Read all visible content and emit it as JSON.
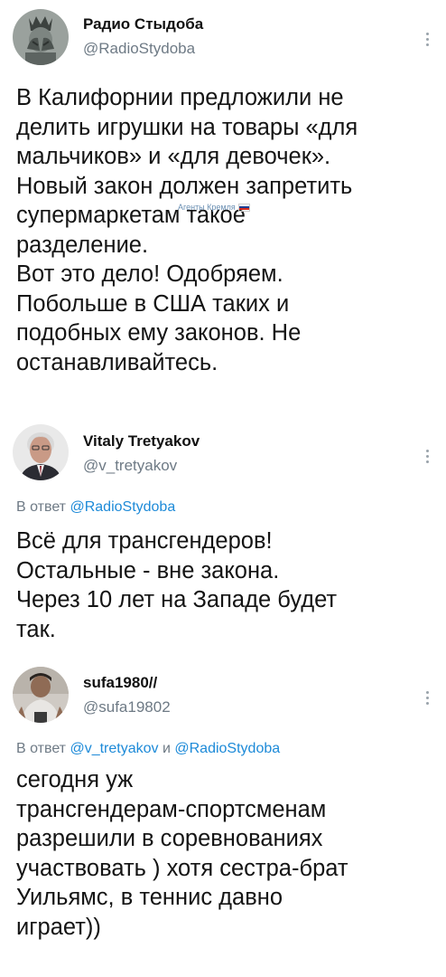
{
  "tweets": [
    {
      "author_name": "Радио Стыдоба",
      "handle": "@RadioStydoba",
      "text": "В Калифорнии предложили не\nделить игрушки на товары «для\nмальчиков» и «для девочек».\nНовый закон должен запретить\nсупермаркетам такое\nразделение.\nВот это дело! Одобряем.\nПобольше в США таких и\nподобных ему законов. Не\nостанавливайтесь.",
      "avatar_icon": "statue-of-liberty-facepalm-avatar"
    },
    {
      "author_name": "Vitaly Tretyakov",
      "handle": "@v_tretyakov",
      "reply_prefix": "В ответ",
      "reply_to": "@RadioStydoba",
      "text": "Всё для трансгендеров!\nОстальные - вне закона.\nЧерез 10 лет на Западе будет\nтак.",
      "avatar_icon": "man-portrait-avatar"
    },
    {
      "author_name": "sufa1980//",
      "handle": "@sufa19802",
      "reply_prefix": "В ответ",
      "reply_to_1": "@v_tretyakov",
      "reply_conj": "и",
      "reply_to_2": "@RadioStydoba",
      "text": "сегодня уж\nтрансгендерам-спортсменам\nразрешили в соревнованиях\nучаствовать ) хотя сестра-брат\nУильямс, в теннис давно\nиграет))",
      "avatar_icon": "man-photo-avatar"
    }
  ],
  "watermark": {
    "text": "Агенты Кремля"
  },
  "colors": {
    "handle": "#6e7a85",
    "link": "#1d8ad8",
    "text": "#141414"
  }
}
